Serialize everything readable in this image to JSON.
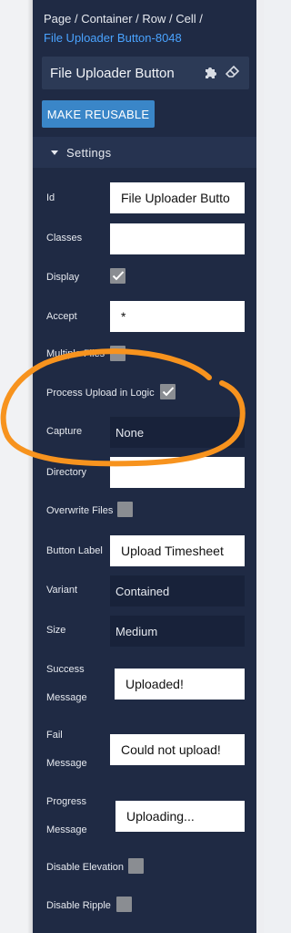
{
  "breadcrumb": {
    "path": "Page / Container / Row / Cell /",
    "current": "File Uploader Button-8048"
  },
  "component": {
    "title": "File Uploader Button",
    "icons": [
      "puzzle-icon",
      "eraser-icon"
    ]
  },
  "make_reusable_label": "MAKE REUSABLE",
  "settings": {
    "header": "Settings",
    "id_label": "Id",
    "id_value": "File Uploader Butto",
    "classes_label": "Classes",
    "classes_value": "",
    "display_label": "Display",
    "display_checked": true,
    "accept_label": "Accept",
    "accept_value": "*",
    "multiple_files_label": "Multiple Files",
    "multiple_files_checked": false,
    "process_upload_label": "Process Upload in Logic",
    "process_upload_checked": true,
    "capture_label": "Capture",
    "capture_value": "None",
    "directory_label": "Directory",
    "directory_value": "",
    "overwrite_files_label": "Overwrite Files",
    "overwrite_files_checked": false,
    "button_label_label": "Button Label",
    "button_label_value": "Upload Timesheet",
    "variant_label": "Variant",
    "variant_value": "Contained",
    "size_label": "Size",
    "size_value": "Medium",
    "success_label_1": "Success",
    "success_label_2": "Message",
    "success_value": "Uploaded!",
    "fail_label_1": "Fail",
    "fail_label_2": "Message",
    "fail_value": "Could not upload!",
    "progress_label_1": "Progress",
    "progress_label_2": "Message",
    "progress_value": "Uploading...",
    "disable_elevation_label": "Disable Elevation",
    "disable_elevation_checked": false,
    "disable_ripple_label": "Disable Ripple",
    "disable_ripple_checked": false
  },
  "colors": {
    "panel_bg": "#1f2a44",
    "accent_blue": "#3a86c8",
    "link_blue": "#4aa3ff",
    "annotation_orange": "#f7931e"
  }
}
